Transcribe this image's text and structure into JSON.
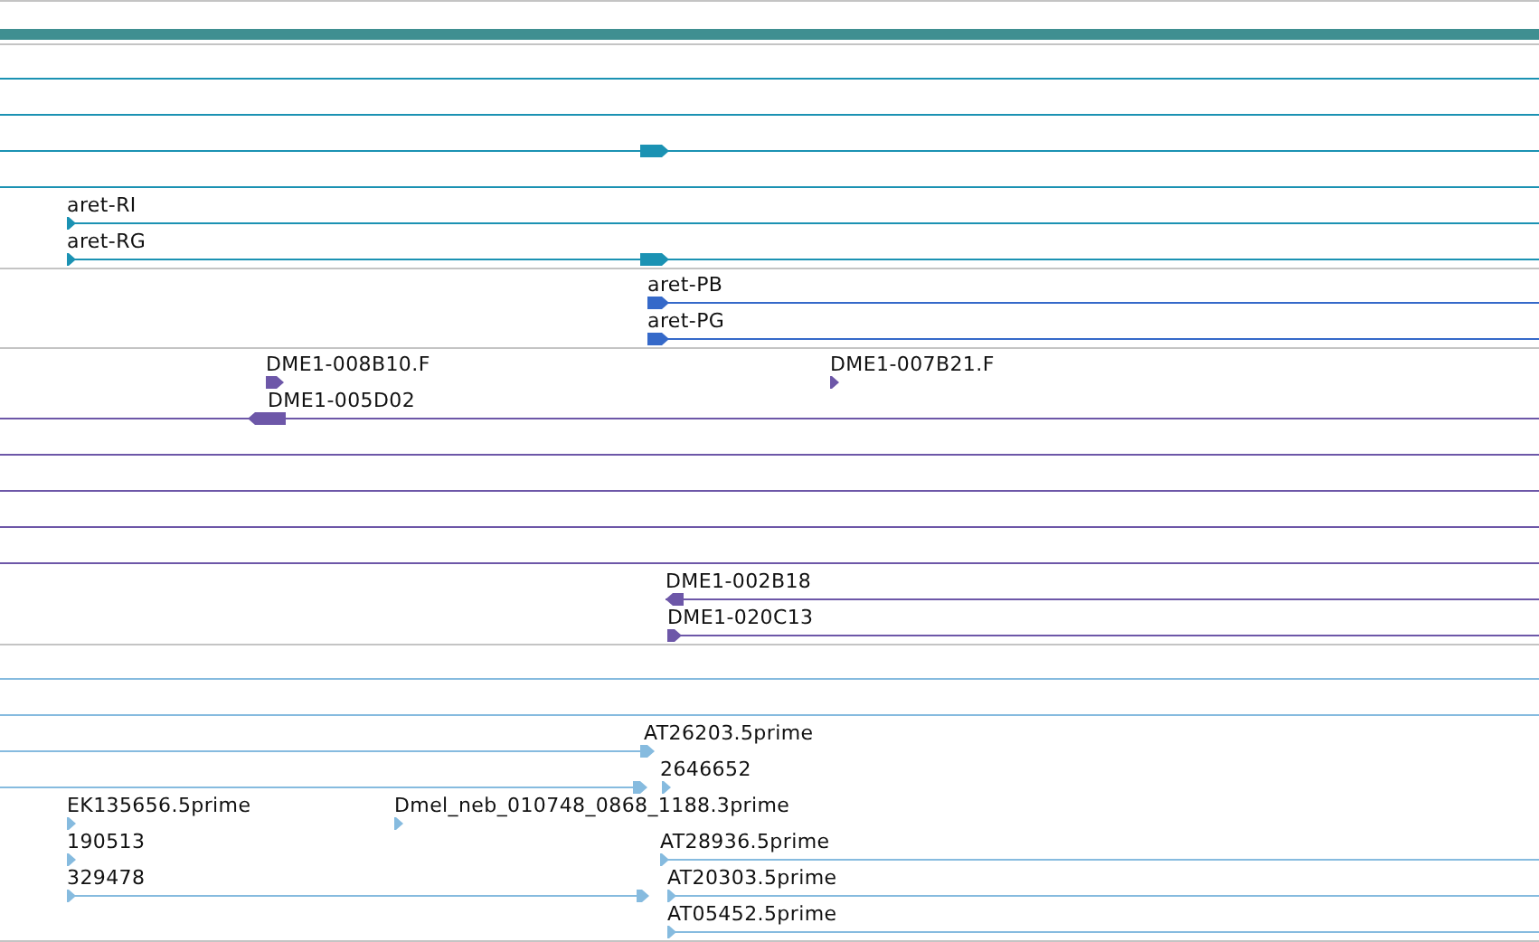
{
  "tracks": [
    {
      "color": "#1b92b3",
      "features": [
        {
          "label": "aret-RI"
        },
        {
          "label": "aret-RG"
        }
      ]
    },
    {
      "color": "#3569c9",
      "features": [
        {
          "label": "aret-PB"
        },
        {
          "label": "aret-PG"
        }
      ]
    },
    {
      "color": "#6d57a8",
      "features": [
        {
          "label": "DME1-008B10.F"
        },
        {
          "label": "DME1-007B21.F"
        },
        {
          "label": "DME1-005D02"
        },
        {
          "label": "DME1-002B18"
        },
        {
          "label": "DME1-020C13"
        }
      ]
    },
    {
      "color": "#86bbdf",
      "features": [
        {
          "label": "AT26203.5prime"
        },
        {
          "label": "2646652"
        },
        {
          "label": "EK135656.5prime"
        },
        {
          "label": "Dmel_neb_010748_0868_1188.3prime"
        },
        {
          "label": "190513"
        },
        {
          "label": "AT28936.5prime"
        },
        {
          "label": "329478"
        },
        {
          "label": "AT20303.5prime"
        },
        {
          "label": "AT05452.5prime"
        }
      ]
    }
  ]
}
